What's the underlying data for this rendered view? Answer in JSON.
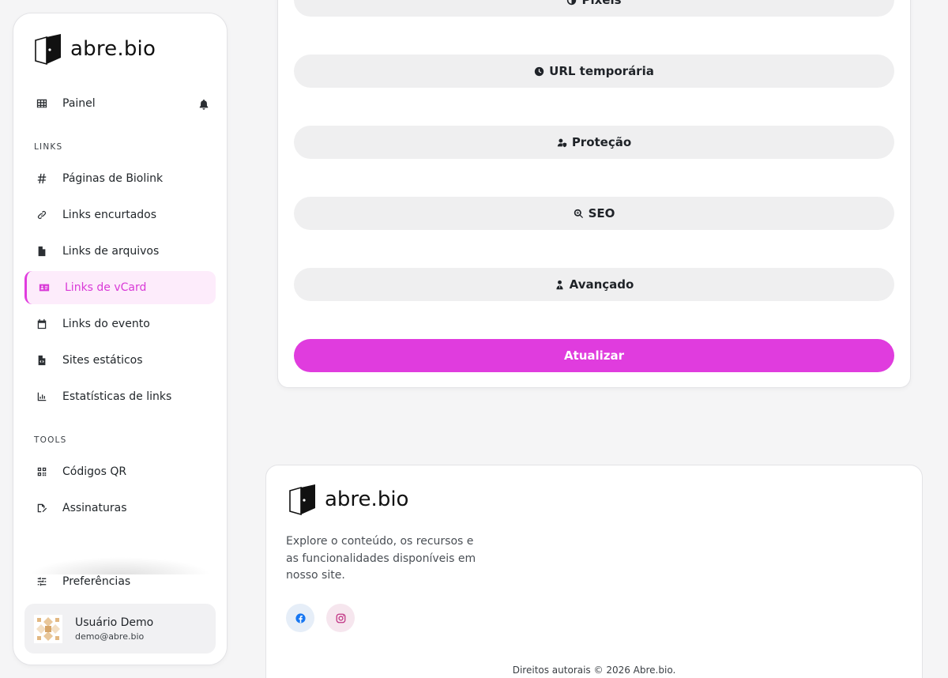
{
  "brand": {
    "name": "abre.bio"
  },
  "sidebar": {
    "dashboard": {
      "label": "Painel"
    },
    "section_links": "LINKS",
    "links": [
      {
        "label": "Páginas de Biolink",
        "icon": "hash-icon"
      },
      {
        "label": "Links encurtados",
        "icon": "link-icon"
      },
      {
        "label": "Links de arquivos",
        "icon": "file-icon"
      },
      {
        "label": "Links de vCard",
        "icon": "id-card-icon",
        "active": true
      },
      {
        "label": "Links do evento",
        "icon": "calendar-icon"
      },
      {
        "label": "Sites estáticos",
        "icon": "file-code-icon"
      },
      {
        "label": "Estatísticas de links",
        "icon": "chart-icon"
      }
    ],
    "section_tools": "TOOLS",
    "tools": [
      {
        "label": "Códigos QR",
        "icon": "qrcode-icon"
      },
      {
        "label": "Assinaturas",
        "icon": "signature-icon"
      }
    ],
    "preferences": {
      "label": "Preferências"
    },
    "user": {
      "name": "Usuário Demo",
      "email": "demo@abre.bio"
    }
  },
  "form": {
    "sections": [
      {
        "label": "Pixels",
        "icon": "adjust-icon"
      },
      {
        "label": "URL temporária",
        "icon": "clock-icon"
      },
      {
        "label": "Proteção",
        "icon": "user-shield-icon"
      },
      {
        "label": "SEO",
        "icon": "search-icon"
      },
      {
        "label": "Avançado",
        "icon": "user-tie-icon"
      }
    ],
    "submit_label": "Atualizar"
  },
  "footer": {
    "description": "Explore o conteúdo, os recursos e as funcionalidades disponíveis em nosso site.",
    "copyright": "Direitos autorais © 2026 Abre.bio."
  },
  "colors": {
    "accent": "#e03cde",
    "active_bg": "#fdecfb"
  }
}
